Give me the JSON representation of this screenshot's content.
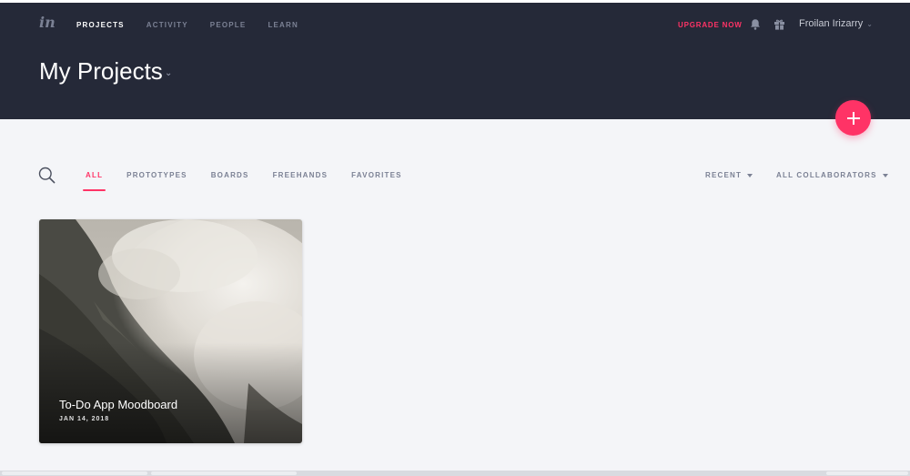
{
  "app": {
    "logo_text": "in"
  },
  "nav": {
    "items": [
      {
        "label": "PROJECTS",
        "active": true
      },
      {
        "label": "ACTIVITY",
        "active": false
      },
      {
        "label": "PEOPLE",
        "active": false
      },
      {
        "label": "LEARN",
        "active": false
      }
    ]
  },
  "header": {
    "upgrade_label": "UPGRADE NOW",
    "user_name": "Froilan Irizarry",
    "bell_icon": "bell-icon",
    "gift_icon": "gift-icon",
    "page_title": "My Projects"
  },
  "filters": {
    "tabs": [
      {
        "label": "ALL",
        "active": true
      },
      {
        "label": "PROTOTYPES",
        "active": false
      },
      {
        "label": "BOARDS",
        "active": false
      },
      {
        "label": "FREEHANDS",
        "active": false
      },
      {
        "label": "FAVORITES",
        "active": false
      }
    ],
    "sort_label": "RECENT",
    "collaborators_label": "ALL COLLABORATORS"
  },
  "projects": [
    {
      "title": "To-Do App Moodboard",
      "date": "JAN 14, 2018",
      "thumbnail": "misty-mountain-image"
    }
  ],
  "colors": {
    "header_bg": "#252938",
    "accent": "#ff3366",
    "page_bg": "#f4f5f8"
  }
}
